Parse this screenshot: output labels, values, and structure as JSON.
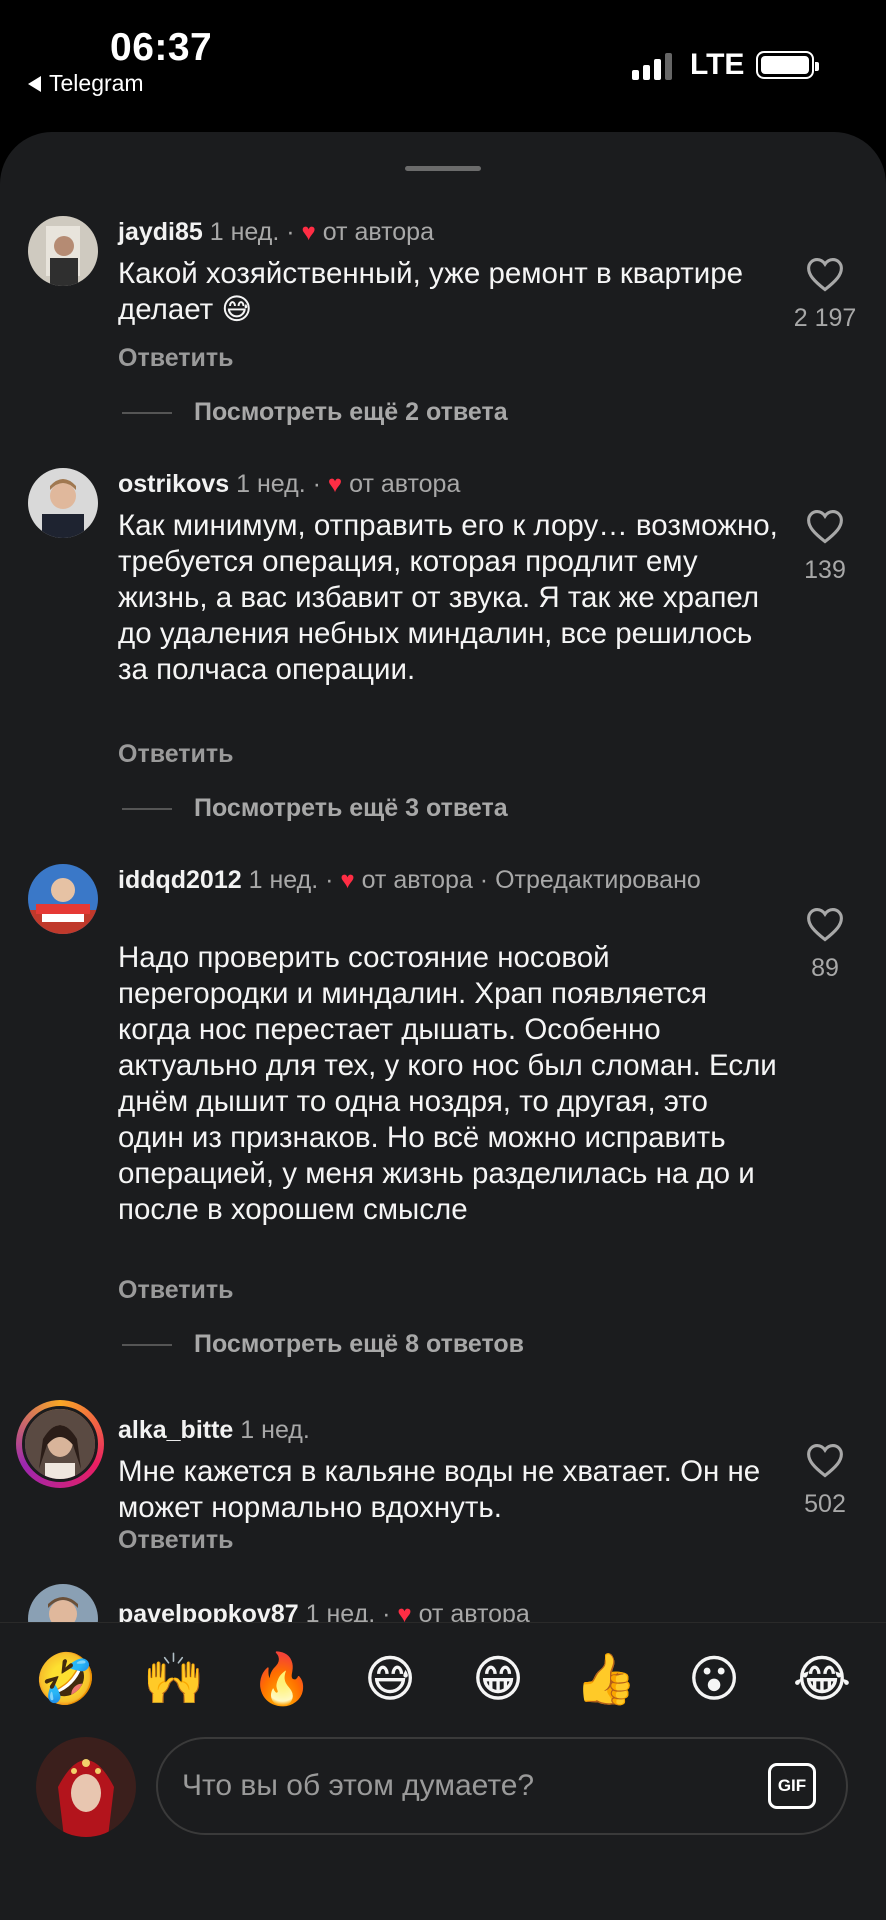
{
  "status_bar": {
    "time": "06:37",
    "back_app": "Telegram",
    "network": "LTE"
  },
  "comments": [
    {
      "username": "jaydi85",
      "age": "1 нед.",
      "author_liked": "от автора",
      "edited": "",
      "text": "Какой хозяйственный, уже ремонт в квартире делает 😅",
      "reply_label": "Ответить",
      "likes": "2 197",
      "more_replies": "Посмотреть ещё 2 ответа"
    },
    {
      "username": "ostrikovs",
      "age": "1 нед.",
      "author_liked": "от автора",
      "edited": "",
      "text": "Как минимум, отправить его к лору… возможно, требуется операция, которая продлит ему жизнь, а вас избавит от звука. Я так же храпел до удаления небных миндалин, все решилось за полчаса операции.",
      "reply_label": "Ответить",
      "likes": "139",
      "more_replies": "Посмотреть ещё 3 ответа"
    },
    {
      "username": "iddqd2012",
      "age": "1 нед.",
      "author_liked": "от автора",
      "edited": "Отредактировано",
      "text": "Надо проверить состояние носовой перегородки и миндалин. Храп появляется когда нос перестает дышать. Особенно актуально для тех, у кого нос был сломан. Если днём дышит то одна ноздря, то другая, это один из признаков. Но всё можно исправить операцией, у меня жизнь разделилась на до и после в хорошем смысле",
      "reply_label": "Ответить",
      "likes": "89",
      "more_replies": "Посмотреть ещё 8 ответов"
    },
    {
      "username": "alka_bitte",
      "age": "1 нед.",
      "author_liked": "",
      "edited": "",
      "text": "Мне кажется в кальяне воды не хватает. Он не может нормально вдохнуть.",
      "reply_label": "Ответить",
      "likes": "502",
      "more_replies": ""
    },
    {
      "username": "pavelpopkov87",
      "age": "1 нед.",
      "author_liked": "от автора",
      "edited": "",
      "text": "",
      "reply_label": "",
      "likes": "",
      "more_replies": ""
    }
  ],
  "reactions": [
    "🤣",
    "🙌",
    "🔥",
    "😅",
    "😁",
    "👍",
    "😮",
    "😂"
  ],
  "composer": {
    "placeholder": "Что вы об этом думаете?",
    "gif_label": "GIF"
  },
  "colors": {
    "sheet_bg": "#1b1c1e",
    "heart_red": "#ff2d44",
    "muted_text": "#a8a8a8"
  },
  "icons": {
    "like": "heart-outline-icon",
    "author_like": "heart-filled-icon",
    "back": "back-triangle-icon",
    "gif": "gif-icon"
  }
}
